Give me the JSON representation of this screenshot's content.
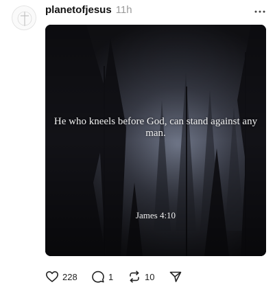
{
  "post": {
    "username": "planetofjesus",
    "time": "11h",
    "image": {
      "quote": "He who kneels before God, can stand against any man.",
      "reference": "James 4:10"
    },
    "actions": {
      "like_count": "228",
      "reply_count": "1",
      "repost_count": "10"
    }
  },
  "icons": {
    "avatar": "cross-logo-icon",
    "more": "more-dots-icon",
    "like": "heart-icon",
    "reply": "comment-bubble-icon",
    "repost": "repost-icon",
    "share": "send-icon"
  },
  "colors": {
    "text": "#111111",
    "muted": "#9a9a9a",
    "image_bg": "#1b1b21"
  }
}
